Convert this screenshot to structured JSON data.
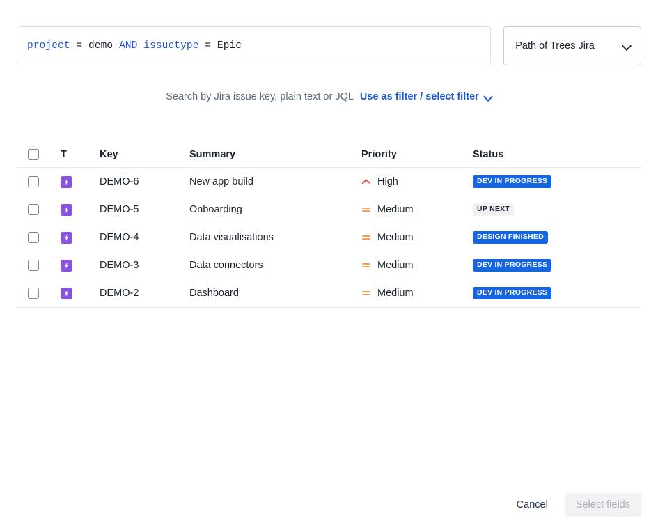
{
  "search": {
    "jql_tokens": [
      {
        "text": "project",
        "type": "field"
      },
      {
        "text": " = ",
        "type": "op"
      },
      {
        "text": "demo",
        "type": "value"
      },
      {
        "text": " ",
        "type": "op"
      },
      {
        "text": "AND",
        "type": "keyword"
      },
      {
        "text": " ",
        "type": "op"
      },
      {
        "text": "issuetype",
        "type": "field"
      },
      {
        "text": " = ",
        "type": "op"
      },
      {
        "text": "Epic",
        "type": "value"
      }
    ],
    "jql_plain": "project = demo AND issuetype = Epic",
    "jql_placeholder": "Search by Jira issue key, plain text or JQL",
    "site_selected": "Path of Trees Jira",
    "site_chevron_icon": "chevron-down-icon",
    "helper_text": "Search by Jira issue key, plain text or JQL",
    "filter_link": "Use as filter / select filter",
    "filter_link_chevron_icon": "chevron-down-icon"
  },
  "table": {
    "columns": {
      "select": "",
      "type": "T",
      "key": "Key",
      "summary": "Summary",
      "priority": "Priority",
      "status": "Status"
    },
    "rows": [
      {
        "key": "DEMO-6",
        "summary": "New app build",
        "type_icon": "epic-icon",
        "priority": "High",
        "priority_icon": "priority-high-icon",
        "status": "DEV IN PROGRESS",
        "status_style": "blue"
      },
      {
        "key": "DEMO-5",
        "summary": "Onboarding",
        "type_icon": "epic-icon",
        "priority": "Medium",
        "priority_icon": "priority-medium-icon",
        "status": "UP NEXT",
        "status_style": "grey"
      },
      {
        "key": "DEMO-4",
        "summary": "Data visualisations",
        "type_icon": "epic-icon",
        "priority": "Medium",
        "priority_icon": "priority-medium-icon",
        "status": "DESIGN FINISHED",
        "status_style": "blue"
      },
      {
        "key": "DEMO-3",
        "summary": "Data connectors",
        "type_icon": "epic-icon",
        "priority": "Medium",
        "priority_icon": "priority-medium-icon",
        "status": "DEV IN PROGRESS",
        "status_style": "blue"
      },
      {
        "key": "DEMO-2",
        "summary": "Dashboard",
        "type_icon": "epic-icon",
        "priority": "Medium",
        "priority_icon": "priority-medium-icon",
        "status": "DEV IN PROGRESS",
        "status_style": "blue"
      }
    ]
  },
  "footer": {
    "cancel_label": "Cancel",
    "submit_label": "Select fields",
    "submit_disabled": true
  },
  "colors": {
    "link_blue": "#1758d6",
    "badge_blue": "#1665e3",
    "badge_grey": "#f1f2f4",
    "epic_purple": "#8952e0",
    "priority_high": "#e2483d",
    "priority_medium": "#f2994a",
    "text_dark": "#1d2330",
    "text_muted": "#5d6b7e",
    "border": "#dcdfe4"
  }
}
